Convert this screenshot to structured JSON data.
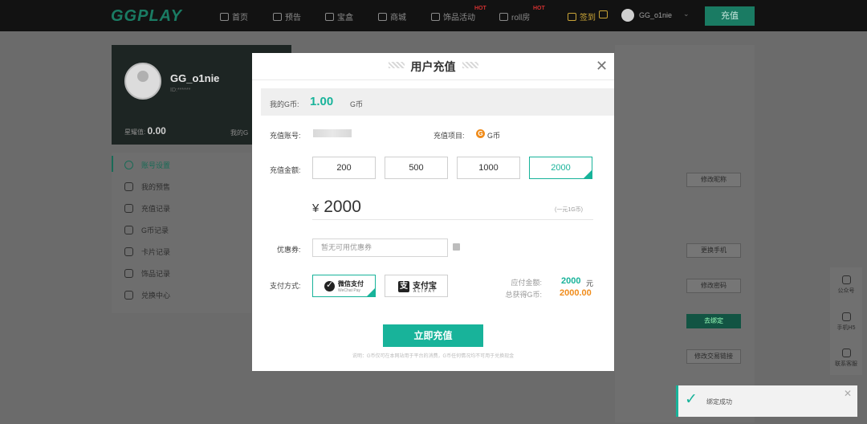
{
  "nav": {
    "logo": "GGPLAY",
    "items": [
      {
        "label": "首页",
        "icon": "home-icon"
      },
      {
        "label": "预告",
        "icon": "preview-icon"
      },
      {
        "label": "宝盒",
        "icon": "box-icon"
      },
      {
        "label": "商城",
        "icon": "store-icon"
      },
      {
        "label": "饰品活动",
        "icon": "gift-icon",
        "hot": "HOT"
      },
      {
        "label": "roll房",
        "icon": "roll-icon",
        "hot": "HOT"
      }
    ],
    "checkin": "签到",
    "username": "GG_o1nie",
    "recharge": "充值"
  },
  "profile": {
    "name": "GG_o1nie",
    "sub": "ID:******",
    "stat_label": "星耀值:",
    "stat_value": "0.00",
    "stat2_label": "我的G"
  },
  "menu": [
    {
      "label": "账号设置",
      "icon": "settings-icon",
      "active": true
    },
    {
      "label": "我的预售",
      "icon": "presale-icon"
    },
    {
      "label": "充值记录",
      "icon": "recharge-record-icon"
    },
    {
      "label": "G币记录",
      "icon": "coin-record-icon"
    },
    {
      "label": "卡片记录",
      "icon": "card-record-icon"
    },
    {
      "label": "饰品记录",
      "icon": "item-record-icon"
    },
    {
      "label": "兑换中心",
      "icon": "exchange-icon"
    }
  ],
  "panel_buttons": [
    "修改昵称",
    "更换手机",
    "修改密码",
    "去绑定",
    "修改交易链接"
  ],
  "float_bar": [
    "公众号",
    "手机H5",
    "联系客服"
  ],
  "modal": {
    "title": "用户充值",
    "balance_label": "我的G币:",
    "balance_value": "1.00",
    "balance_unit": "G币",
    "account_label": "充值账号:",
    "item_label": "充值项目:",
    "item_coin": "G",
    "item_value": "G币",
    "amount_label": "充值金额:",
    "amounts": [
      "200",
      "500",
      "1000",
      "2000"
    ],
    "selected_amount": "2000",
    "currency_symbol": "¥",
    "rate_note": "(一元1G币)",
    "coupon_label": "优惠券:",
    "coupon_placeholder": "暂无可用优惠券",
    "pay_label": "支付方式:",
    "wechat_name": "微信支付",
    "wechat_sub": "WeChat Pay",
    "alipay_logo": "支",
    "alipay_name": "支付宝",
    "alipay_sub": "ALIPAY",
    "pay_amount_label": "应付金额:",
    "pay_amount_value": "2000",
    "pay_amount_unit": "元",
    "get_coin_label": "总获得G币:",
    "get_coin_value": "2000.00",
    "submit": "立即充值",
    "footnote": "说明：G币仅可在本网站用于平台的消费，G币任何情况均不可用于兑换现金"
  },
  "toast": {
    "text": "绑定成功"
  },
  "colors": {
    "accent": "#18b39a",
    "brand": "#1a7b63",
    "orange": "#f08c1b"
  }
}
